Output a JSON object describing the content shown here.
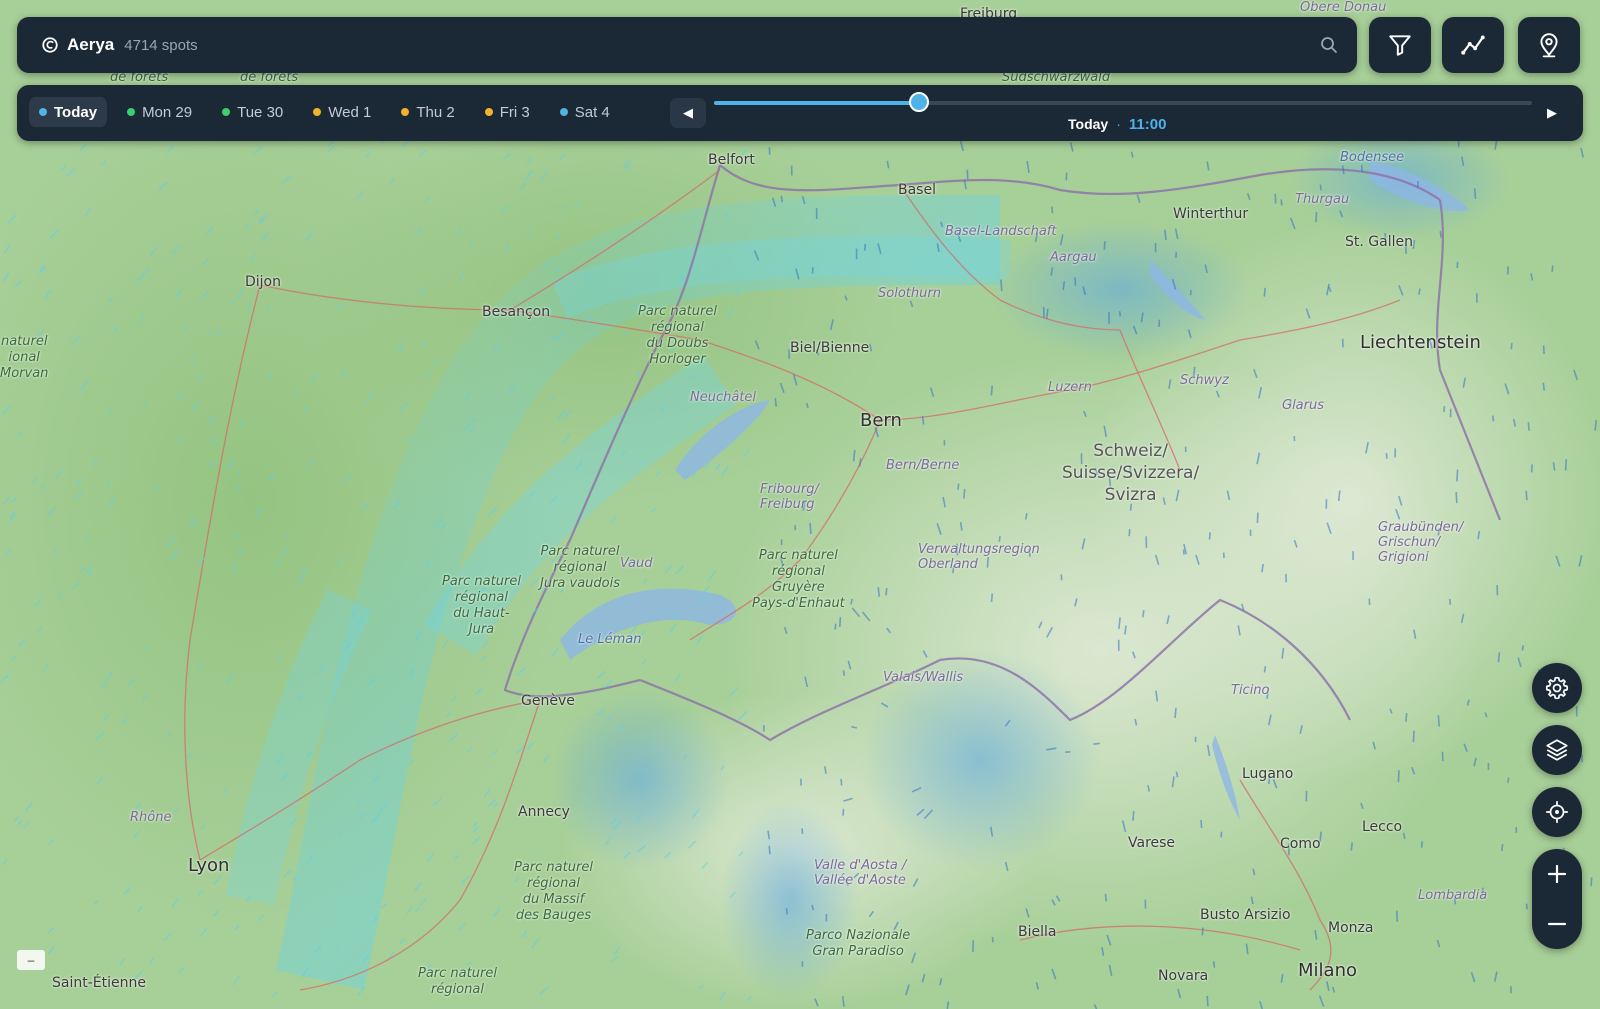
{
  "header": {
    "app_title": "Aerya",
    "spot_count": "4714 spots",
    "logo_icon": "aerya-logo-icon",
    "search_icon": "search-icon"
  },
  "toolbar": {
    "filter_icon": "filter-icon",
    "chart_icon": "chart-line-icon",
    "location_icon": "map-pin-icon"
  },
  "timeline": {
    "days": [
      {
        "label": "Today",
        "color": "#4fb3e8",
        "active": true
      },
      {
        "label": "Mon 29",
        "color": "#3ecf6a",
        "active": false
      },
      {
        "label": "Tue 30",
        "color": "#3ecf6a",
        "active": false
      },
      {
        "label": "Wed 1",
        "color": "#f2b32a",
        "active": false
      },
      {
        "label": "Thu 2",
        "color": "#f2b32a",
        "active": false
      },
      {
        "label": "Fri 3",
        "color": "#f2b32a",
        "active": false
      },
      {
        "label": "Sat 4",
        "color": "#4fb3e8",
        "active": false
      }
    ],
    "prev_label": "◀",
    "next_label": "▶",
    "slider_fraction": 0.25,
    "time_day": "Today",
    "time_separator": "·",
    "time_hour": "11:00",
    "accent_color": "#4fb3e8"
  },
  "controls": {
    "settings_icon": "gear-icon",
    "layers_icon": "layers-icon",
    "locate_icon": "crosshair-icon",
    "zoom_in_icon": "plus-icon",
    "zoom_out_icon": "minus-icon"
  },
  "scale_label": "–",
  "map": {
    "places": [
      {
        "id": "fraiburg",
        "text": "Freiburg",
        "kind": "city"
      },
      {
        "id": "obere-donau",
        "text": "Obere Donau",
        "kind": "region"
      },
      {
        "id": "suedschwarzwald",
        "text": "Südschwarzwald",
        "kind": "park"
      },
      {
        "id": "belfort",
        "text": "Belfort",
        "kind": "city"
      },
      {
        "id": "basel",
        "text": "Basel",
        "kind": "city"
      },
      {
        "id": "basel-landschaft",
        "text": "Basel-Landschaft",
        "kind": "region"
      },
      {
        "id": "winterthur",
        "text": "Winterthur",
        "kind": "city"
      },
      {
        "id": "thurgau",
        "text": "Thurgau",
        "kind": "region"
      },
      {
        "id": "bodensee",
        "text": "Bodensee",
        "kind": "water"
      },
      {
        "id": "st-gallen",
        "text": "St. Gallen",
        "kind": "city"
      },
      {
        "id": "aargau",
        "text": "Aargau",
        "kind": "region"
      },
      {
        "id": "solothurn",
        "text": "Solothurn",
        "kind": "region"
      },
      {
        "id": "dijon",
        "text": "Dijon",
        "kind": "city"
      },
      {
        "id": "besancon",
        "text": "Besançon",
        "kind": "city"
      },
      {
        "id": "parc-doubs",
        "text": "Parc naturel\nrégional\ndu Doubs\nHorloger",
        "kind": "park"
      },
      {
        "id": "biel",
        "text": "Biel/Bienne",
        "kind": "city"
      },
      {
        "id": "liechtenstein",
        "text": "Liechtenstein",
        "kind": "big"
      },
      {
        "id": "morvan",
        "text": "naturel\nional\nMorvan",
        "kind": "park"
      },
      {
        "id": "neuchatel",
        "text": "Neuchâtel",
        "kind": "region"
      },
      {
        "id": "luzern",
        "text": "Luzern",
        "kind": "region"
      },
      {
        "id": "schwyz",
        "text": "Schwyz",
        "kind": "region"
      },
      {
        "id": "glarus",
        "text": "Glarus",
        "kind": "region"
      },
      {
        "id": "bern",
        "text": "Bern",
        "kind": "big"
      },
      {
        "id": "bern-berne",
        "text": "Bern/Berne",
        "kind": "region"
      },
      {
        "id": "schweiz",
        "text": "Schweiz/\nSuisse/Svizzera/\nSvizra",
        "kind": "country"
      },
      {
        "id": "fribourg",
        "text": "Fribourg/\nFreiburg",
        "kind": "region"
      },
      {
        "id": "graubuenden",
        "text": "Graubünden/\nGrischun/\nGrigioni",
        "kind": "region"
      },
      {
        "id": "oberland",
        "text": "Verwaltungsregion\nOberland",
        "kind": "region"
      },
      {
        "id": "parc-vaudois",
        "text": "Parc naturel\nrégional\nJura vaudois",
        "kind": "park"
      },
      {
        "id": "vaud",
        "text": "Vaud",
        "kind": "region"
      },
      {
        "id": "parc-gruyere",
        "text": "Parc naturel\nrégional\nGruyère\nPays-d'Enhaut",
        "kind": "park"
      },
      {
        "id": "parc-haut-jura",
        "text": "Parc naturel\nrégional\ndu Haut-\nJura",
        "kind": "park"
      },
      {
        "id": "le-leman",
        "text": "Le Léman",
        "kind": "water"
      },
      {
        "id": "valais",
        "text": "Valais/Wallis",
        "kind": "region"
      },
      {
        "id": "geneve",
        "text": "Genève",
        "kind": "city"
      },
      {
        "id": "ticino",
        "text": "Ticino",
        "kind": "region"
      },
      {
        "id": "lugano",
        "text": "Lugano",
        "kind": "city"
      },
      {
        "id": "rhone",
        "text": "Rhône",
        "kind": "region"
      },
      {
        "id": "annecy",
        "text": "Annecy",
        "kind": "city"
      },
      {
        "id": "lyon",
        "text": "Lyon",
        "kind": "big"
      },
      {
        "id": "varese",
        "text": "Varese",
        "kind": "city"
      },
      {
        "id": "como",
        "text": "Como",
        "kind": "city"
      },
      {
        "id": "lecco",
        "text": "Lecco",
        "kind": "city"
      },
      {
        "id": "parc-bauges",
        "text": "Parc naturel\nrégional\ndu Massif\ndes Bauges",
        "kind": "park"
      },
      {
        "id": "valle-aosta",
        "text": "Valle d'Aosta /\nVallée d'Aoste",
        "kind": "region"
      },
      {
        "id": "lombardia",
        "text": "Lombardia",
        "kind": "region"
      },
      {
        "id": "biella",
        "text": "Biella",
        "kind": "city"
      },
      {
        "id": "busto",
        "text": "Busto Arsizio",
        "kind": "city"
      },
      {
        "id": "monza",
        "text": "Monza",
        "kind": "city"
      },
      {
        "id": "gran-paradiso",
        "text": "Parco Nazionale\nGran Paradiso",
        "kind": "park"
      },
      {
        "id": "saint-etienne",
        "text": "Saint-Étienne",
        "kind": "city"
      },
      {
        "id": "parc-regional-s",
        "text": "Parc naturel\nrégional",
        "kind": "park"
      },
      {
        "id": "novara",
        "text": "Novara",
        "kind": "city"
      },
      {
        "id": "milano",
        "text": "Milano",
        "kind": "big"
      },
      {
        "id": "de-forets-1",
        "text": "de forêts",
        "kind": "park"
      },
      {
        "id": "de-forets-2",
        "text": "de forêts",
        "kind": "park"
      }
    ]
  }
}
